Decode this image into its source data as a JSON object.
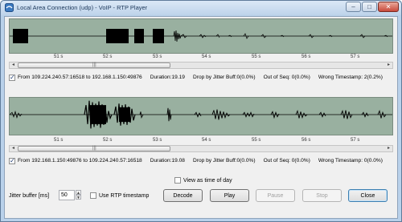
{
  "window": {
    "title": "Local Area Connection (udp) - VoIP - RTP Player",
    "minimize": "‒",
    "maximize": "□",
    "close": "✕"
  },
  "streams": [
    {
      "checked": true,
      "from": "From 109.224.240.57:16518 to 192.168.1.150:49876",
      "duration": "Duration:19.19",
      "drop": "Drop by Jitter Buff:0(0.0%)",
      "out_of_seq": "Out of Seq: 0(0.0%)",
      "wrong_ts": "Wrong Timestamp: 2(0.2%)"
    },
    {
      "checked": true,
      "from": "From 192.168.1.150:49876 to 109.224.240.57:16518",
      "duration": "Duration:19.08",
      "drop": "Drop by Jitter Buff:0(0.0%)",
      "out_of_seq": "Out of Seq: 0(0.0%)",
      "wrong_ts": "Wrong Timestamp: 0(0.0%)"
    }
  ],
  "time_axis": {
    "labels": [
      "51 s",
      "52 s",
      "53 s",
      "54 s",
      "55 s",
      "56 s",
      "57 s"
    ]
  },
  "scroll": {
    "left_arrow": "◂",
    "right_arrow": "▸",
    "grip": "|||"
  },
  "view_as_time_of_day": {
    "label": "View as time of day",
    "checked": false
  },
  "jitter_buffer": {
    "label": "Jitter buffer [ms]",
    "value": "50",
    "up": "▲",
    "down": "▼"
  },
  "use_rtp_timestamp": {
    "label": "Use RTP timestamp",
    "checked": false
  },
  "buttons": {
    "decode": "Decode",
    "play": "Play",
    "pause": "Pause",
    "stop": "Stop",
    "close": "Close"
  },
  "colors": {
    "waveform_bg": "#99b0a0",
    "waveform": "#000000",
    "window_frame": "#b9d1ea"
  }
}
